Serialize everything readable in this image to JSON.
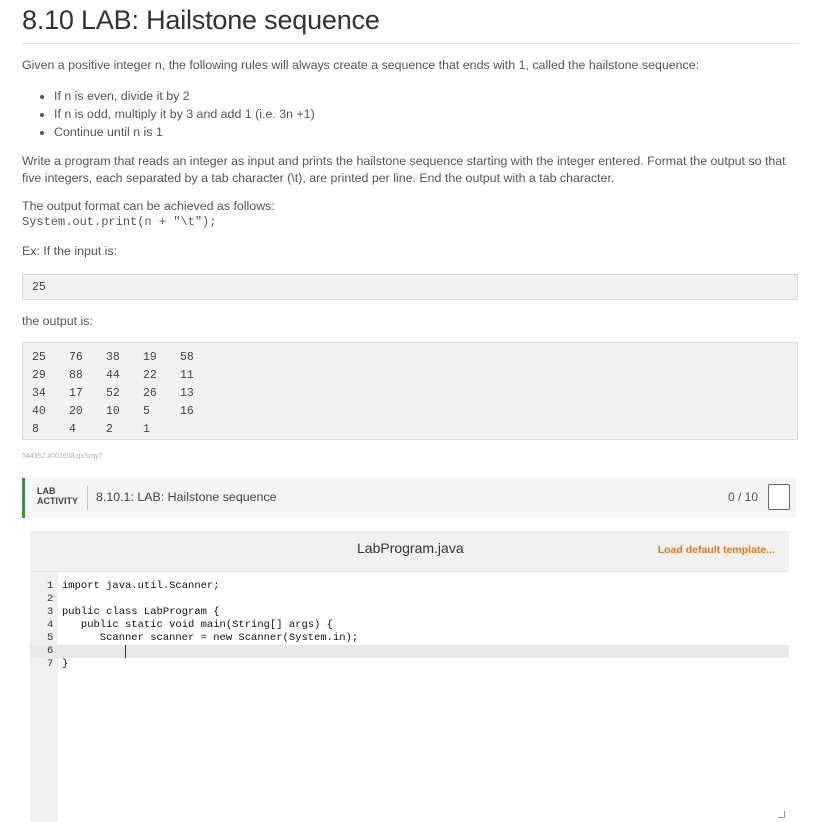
{
  "page": {
    "title": "8.10 LAB: Hailstone sequence",
    "intro": "Given a positive integer n, the following rules will always create a sequence that ends with 1, called the hailstone sequence:",
    "rules": [
      "If n is even, divide it by 2",
      "If n is odd, multiply it by 3 and add 1 (i.e. 3n +1)",
      "Continue until n is 1"
    ],
    "write": "Write a program that reads an integer as input and prints the hailstone sequence starting with the integer entered. Format the output so that five integers, each separated by a tab character (\\t), are printed per line. End the output with a tab character.",
    "format_text": "The output format can be achieved as follows:",
    "format_code": "System.out.print(n + \"\\t\");",
    "example_label": "Ex: If the input is:",
    "example_input": "25",
    "output_label": "the output is:",
    "output_rows": [
      [
        "25",
        "76",
        "38",
        "19",
        "58"
      ],
      [
        "29",
        "88",
        "44",
        "22",
        "11"
      ],
      [
        "34",
        "17",
        "52",
        "26",
        "13"
      ],
      [
        "40",
        "20",
        "10",
        "5",
        "16"
      ],
      [
        "8",
        "4",
        "2",
        "1",
        ""
      ]
    ],
    "tag": "544352.4001658.qx3zqy7"
  },
  "lab": {
    "label_line1": "LAB",
    "label_line2": "ACTIVITY",
    "title": "8.10.1: LAB: Hailstone sequence",
    "score": "0 / 10",
    "accent_color": "#2e9a45"
  },
  "editor": {
    "file_name": "LabProgram.java",
    "load_template": "Load default template...",
    "load_color": "#e07a16",
    "lines": [
      {
        "num": "1",
        "code": "import java.util.Scanner;"
      },
      {
        "num": "2",
        "code": ""
      },
      {
        "num": "3",
        "code": "public class LabProgram {"
      },
      {
        "num": "4",
        "code": "   public static void main(String[] args) {"
      },
      {
        "num": "5",
        "code": "      Scanner scanner = new Scanner(System.in);"
      },
      {
        "num": "6",
        "code": ""
      },
      {
        "num": "7",
        "code": "}"
      }
    ]
  }
}
